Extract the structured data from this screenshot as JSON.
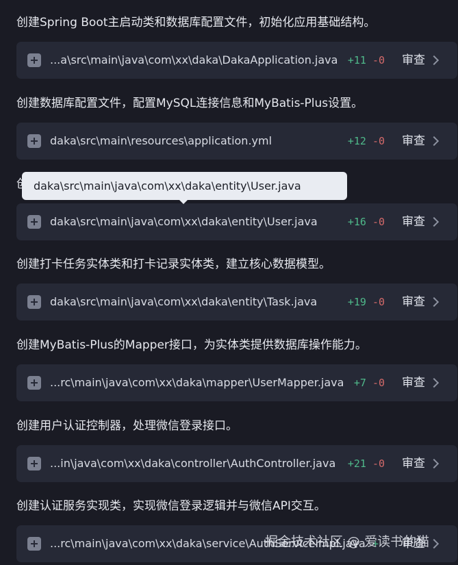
{
  "sections": [
    {
      "description": "创建Spring Boot主启动类和数据库配置文件，初始化应用基础结构。",
      "file": "...a\\src\\main\\java\\com\\xx\\daka\\DakaApplication.java",
      "added": "+11",
      "removed": "-0",
      "review_label": "审查"
    },
    {
      "description": "创建数据库配置文件，配置MySQL连接信息和MyBatis-Plus设置。",
      "file": "daka\\src\\main\\resources\\application.yml",
      "added": "+12",
      "removed": "-0",
      "review_label": "审查"
    },
    {
      "description": "创",
      "file": "daka\\src\\main\\java\\com\\xx\\daka\\entity\\User.java",
      "added": "+16",
      "removed": "-0",
      "review_label": "审查"
    },
    {
      "description": "创建打卡任务实体类和打卡记录实体类，建立核心数据模型。",
      "file": "daka\\src\\main\\java\\com\\xx\\daka\\entity\\Task.java",
      "added": "+19",
      "removed": "-0",
      "review_label": "审查"
    },
    {
      "description": "创建MyBatis-Plus的Mapper接口，为实体类提供数据库操作能力。",
      "file": "...rc\\main\\java\\com\\xx\\daka\\mapper\\UserMapper.java",
      "added": "+7",
      "removed": "-0",
      "review_label": "审查"
    },
    {
      "description": "创建用户认证控制器，处理微信登录接口。",
      "file": "...in\\java\\com\\xx\\daka\\controller\\AuthController.java",
      "added": "+21",
      "removed": "-0",
      "review_label": "审查"
    },
    {
      "description": "创建认证服务实现类，实现微信登录逻辑并与微信API交互。",
      "file": "...rc\\main\\java\\com\\xx\\daka\\service\\AuthServiceImpl.java",
      "added": "+",
      "removed": "",
      "review_label": "审查"
    }
  ],
  "tooltip": {
    "text": "daka\\src\\main\\java\\com\\xx\\daka\\entity\\User.java"
  },
  "watermark": "掘金技术社区 @ 爱读书的猫",
  "colors": {
    "background": "#1a1b24",
    "card": "#262936",
    "added": "#4fb98a",
    "removed": "#d46a6a"
  },
  "icons": {
    "expand": "plus-square-icon",
    "open": "chevron-right-icon"
  }
}
